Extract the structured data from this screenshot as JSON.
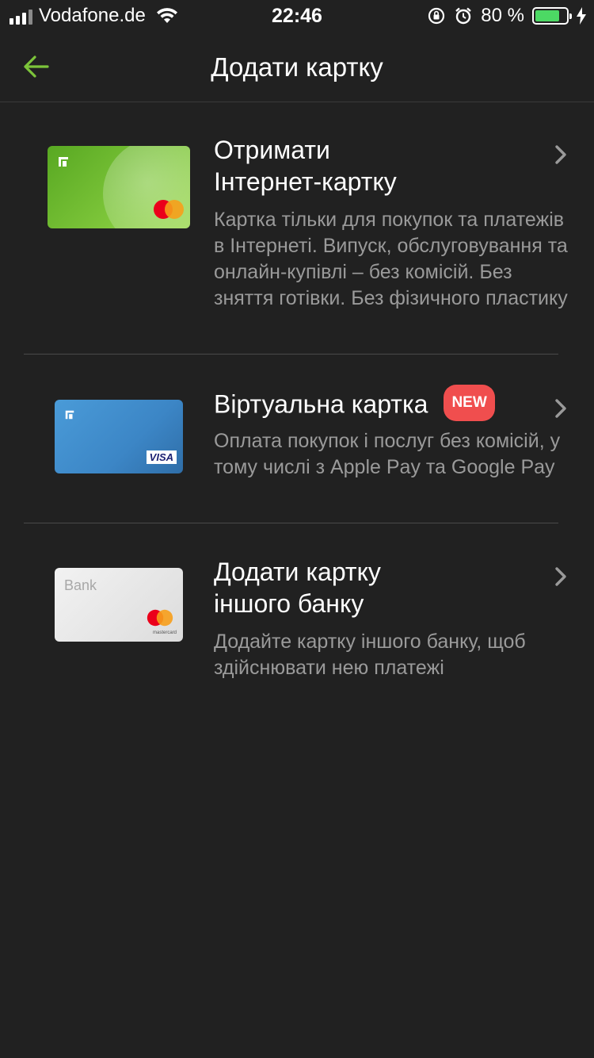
{
  "status_bar": {
    "carrier": "Vodafone.de",
    "time": "22:46",
    "battery_percent": "80 %",
    "battery_level": 0.8
  },
  "nav": {
    "title": "Додати картку"
  },
  "items": [
    {
      "title_line1": "Отримати",
      "title_line2": "Інтернет-картку",
      "description": "Картка тільки для покупок та платежів в Інтернеті. Випуск, обслуговування та онлайн-купівлі – без комісій. Без зняття готівки. Без фізичного пластику",
      "card_type": "mastercard"
    },
    {
      "title_line1": "Віртуальна картка",
      "badge": "NEW",
      "description": "Оплата покупок і послуг без комісій, у тому числі з Apple Pay та Google Pay",
      "card_network_label": "VISA"
    },
    {
      "title_line1": "Додати картку",
      "title_line2": "іншого банку",
      "description": "Додайте картку іншого банку, щоб здійснювати нею платежі",
      "card_bank_label": "Bank",
      "card_network_small": "mastercard"
    }
  ],
  "colors": {
    "background": "#212121",
    "accent_green": "#7cc43a",
    "badge_red": "#f04e4e",
    "secondary_text": "#9a9a9a"
  }
}
